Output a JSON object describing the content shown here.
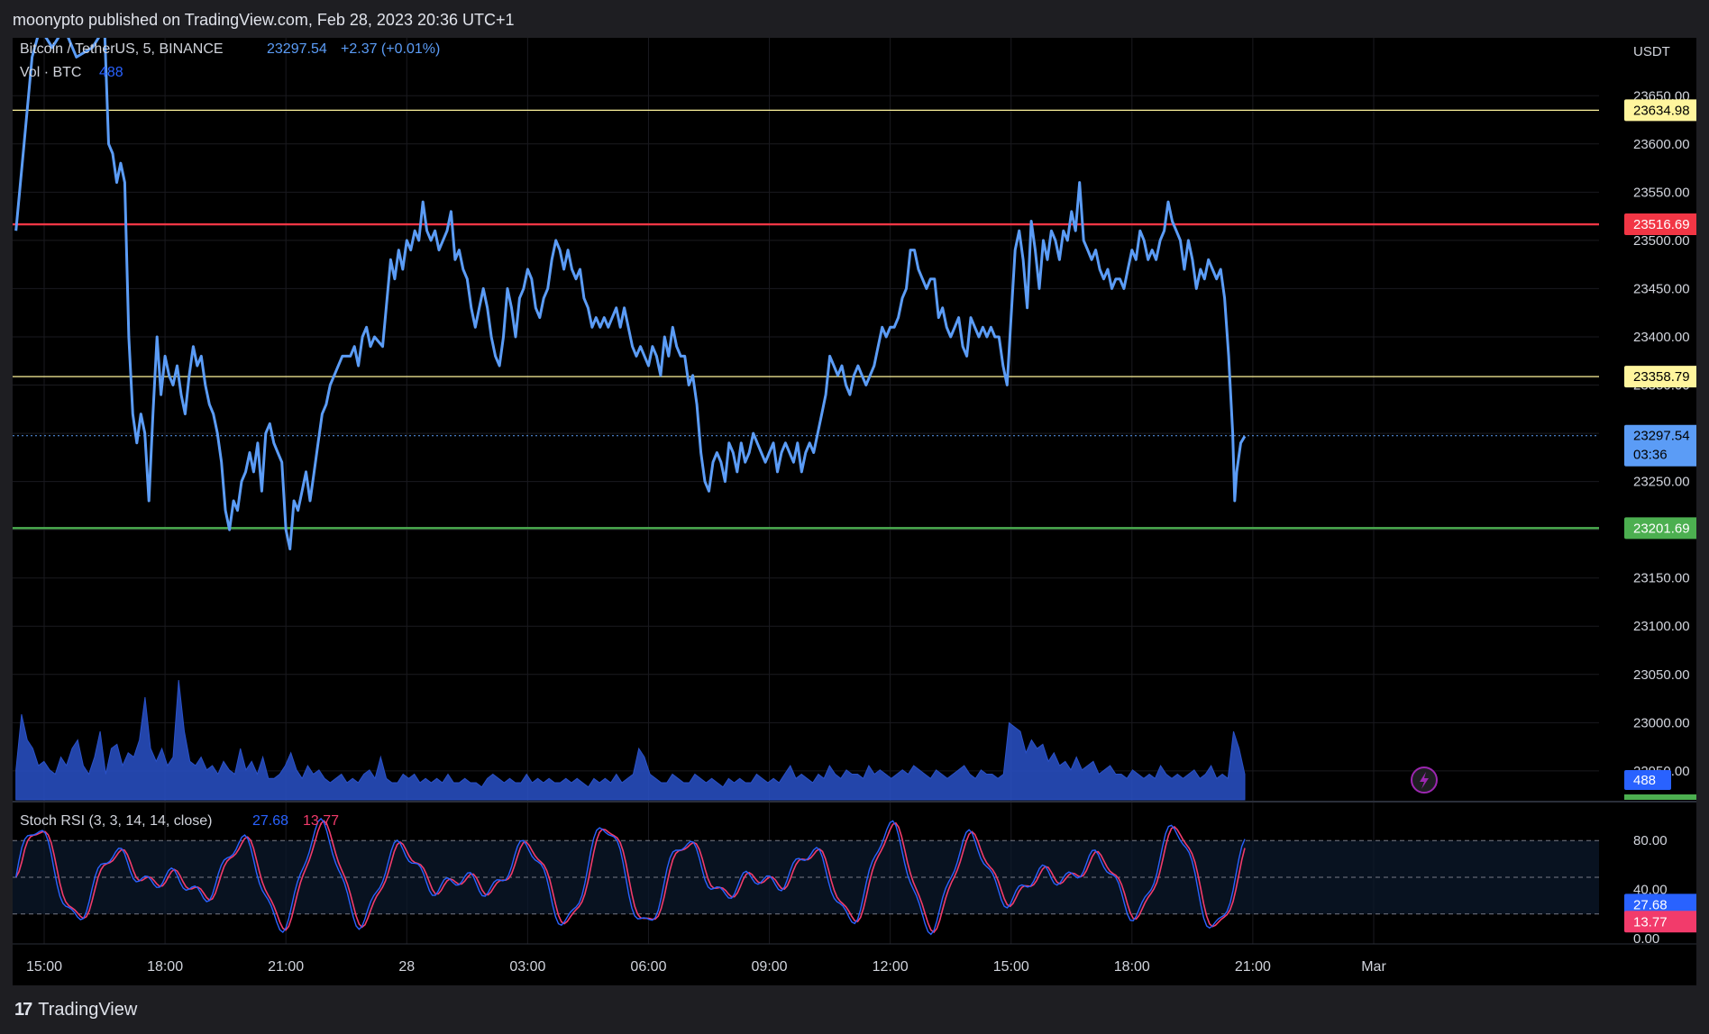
{
  "header": {
    "published": "moonypto published on TradingView.com, Feb 28, 2023 20:36 UTC+1"
  },
  "legend": {
    "symbol": "Bitcoin / TetherUS, 5, BINANCE",
    "price": "23297.54",
    "change": "+2.37 (+0.01%)",
    "volume_label": "Vol · BTC",
    "volume_value": "488"
  },
  "stoch_legend": {
    "label": "Stoch RSI (3, 3, 14, 14, close)",
    "k": "27.68",
    "d": "13.77"
  },
  "footer": {
    "brand": "TradingView",
    "logo_icon": "tradingview-logo-icon"
  },
  "colors": {
    "price_line": "#5b9cf6",
    "resistance": "#f23645",
    "support": "#4caf50",
    "level_yellow": "#fff59d",
    "volume": "#2951c8",
    "stoch_k": "#2962ff",
    "stoch_d": "#f23b6b"
  },
  "chart_data": {
    "type": "line",
    "price_axis": {
      "currency": "USDT",
      "ylim": [
        22920,
        23710
      ],
      "ticks": [
        "23650.00",
        "23600.00",
        "23550.00",
        "23500.00",
        "23450.00",
        "23400.00",
        "23350.00",
        "23300.00",
        "23250.00",
        "23200.00",
        "23150.00",
        "23100.00",
        "23050.00",
        "23000.00",
        "22950.00"
      ]
    },
    "time_axis": {
      "labels": [
        "15:00",
        "18:00",
        "21:00",
        "28",
        "03:00",
        "06:00",
        "09:00",
        "12:00",
        "15:00",
        "18:00",
        "21:00",
        "Mar"
      ],
      "hours": [
        0,
        3,
        6,
        9,
        12,
        15,
        18,
        21,
        24,
        27,
        30,
        33
      ]
    },
    "horizontal_levels": [
      {
        "value": 23634.98,
        "label": "23634.98",
        "color": "#fff59d"
      },
      {
        "value": 23516.69,
        "label": "23516.69",
        "color": "#f23645"
      },
      {
        "value": 23358.79,
        "label": "23358.79",
        "color": "#fff59d"
      },
      {
        "value": 23201.69,
        "label": "23201.69",
        "color": "#4caf50"
      }
    ],
    "last_price": {
      "value": 23297.54,
      "label": "23297.54",
      "countdown": "03:36"
    },
    "price_series": [
      [
        -0.7,
        23510
      ],
      [
        -0.5,
        23600
      ],
      [
        -0.3,
        23690
      ],
      [
        -0.1,
        23720
      ],
      [
        0.2,
        23700
      ],
      [
        0.5,
        23720
      ],
      [
        0.8,
        23690
      ],
      [
        1.2,
        23700
      ],
      [
        1.5,
        23720
      ],
      [
        1.6,
        23600
      ],
      [
        1.7,
        23590
      ],
      [
        1.8,
        23560
      ],
      [
        1.9,
        23580
      ],
      [
        2.0,
        23560
      ],
      [
        2.1,
        23400
      ],
      [
        2.2,
        23320
      ],
      [
        2.3,
        23290
      ],
      [
        2.4,
        23320
      ],
      [
        2.5,
        23300
      ],
      [
        2.6,
        23230
      ],
      [
        2.7,
        23320
      ],
      [
        2.8,
        23400
      ],
      [
        2.9,
        23340
      ],
      [
        3.0,
        23380
      ],
      [
        3.1,
        23360
      ],
      [
        3.2,
        23350
      ],
      [
        3.3,
        23370
      ],
      [
        3.4,
        23340
      ],
      [
        3.5,
        23320
      ],
      [
        3.6,
        23360
      ],
      [
        3.7,
        23390
      ],
      [
        3.8,
        23370
      ],
      [
        3.9,
        23380
      ],
      [
        4.0,
        23350
      ],
      [
        4.1,
        23330
      ],
      [
        4.2,
        23320
      ],
      [
        4.3,
        23300
      ],
      [
        4.4,
        23270
      ],
      [
        4.5,
        23220
      ],
      [
        4.6,
        23200
      ],
      [
        4.7,
        23230
      ],
      [
        4.8,
        23220
      ],
      [
        4.9,
        23250
      ],
      [
        5.0,
        23260
      ],
      [
        5.1,
        23280
      ],
      [
        5.2,
        23260
      ],
      [
        5.3,
        23290
      ],
      [
        5.4,
        23240
      ],
      [
        5.5,
        23300
      ],
      [
        5.6,
        23310
      ],
      [
        5.7,
        23290
      ],
      [
        5.8,
        23280
      ],
      [
        5.9,
        23270
      ],
      [
        6.0,
        23200
      ],
      [
        6.1,
        23180
      ],
      [
        6.2,
        23230
      ],
      [
        6.3,
        23220
      ],
      [
        6.4,
        23240
      ],
      [
        6.5,
        23260
      ],
      [
        6.6,
        23230
      ],
      [
        6.7,
        23260
      ],
      [
        6.8,
        23290
      ],
      [
        6.9,
        23320
      ],
      [
        7.0,
        23330
      ],
      [
        7.1,
        23350
      ],
      [
        7.2,
        23360
      ],
      [
        7.3,
        23370
      ],
      [
        7.4,
        23380
      ],
      [
        7.5,
        23380
      ],
      [
        7.6,
        23380
      ],
      [
        7.7,
        23390
      ],
      [
        7.8,
        23370
      ],
      [
        7.9,
        23400
      ],
      [
        8.0,
        23410
      ],
      [
        8.1,
        23390
      ],
      [
        8.2,
        23400
      ],
      [
        8.4,
        23390
      ],
      [
        8.6,
        23480
      ],
      [
        8.7,
        23460
      ],
      [
        8.8,
        23490
      ],
      [
        8.9,
        23470
      ],
      [
        9.0,
        23500
      ],
      [
        9.1,
        23490
      ],
      [
        9.2,
        23510
      ],
      [
        9.3,
        23500
      ],
      [
        9.4,
        23540
      ],
      [
        9.5,
        23510
      ],
      [
        9.6,
        23500
      ],
      [
        9.7,
        23510
      ],
      [
        9.8,
        23490
      ],
      [
        10.0,
        23510
      ],
      [
        10.1,
        23530
      ],
      [
        10.2,
        23480
      ],
      [
        10.3,
        23490
      ],
      [
        10.4,
        23470
      ],
      [
        10.5,
        23460
      ],
      [
        10.6,
        23430
      ],
      [
        10.7,
        23410
      ],
      [
        10.8,
        23430
      ],
      [
        10.9,
        23450
      ],
      [
        11.0,
        23430
      ],
      [
        11.1,
        23400
      ],
      [
        11.2,
        23380
      ],
      [
        11.3,
        23370
      ],
      [
        11.4,
        23400
      ],
      [
        11.5,
        23450
      ],
      [
        11.6,
        23430
      ],
      [
        11.7,
        23400
      ],
      [
        11.8,
        23440
      ],
      [
        11.9,
        23450
      ],
      [
        12.0,
        23470
      ],
      [
        12.1,
        23460
      ],
      [
        12.2,
        23430
      ],
      [
        12.3,
        23420
      ],
      [
        12.4,
        23440
      ],
      [
        12.5,
        23450
      ],
      [
        12.6,
        23480
      ],
      [
        12.7,
        23500
      ],
      [
        12.8,
        23490
      ],
      [
        12.9,
        23470
      ],
      [
        13.0,
        23490
      ],
      [
        13.1,
        23470
      ],
      [
        13.2,
        23460
      ],
      [
        13.3,
        23470
      ],
      [
        13.4,
        23440
      ],
      [
        13.5,
        23430
      ],
      [
        13.6,
        23410
      ],
      [
        13.7,
        23420
      ],
      [
        13.8,
        23410
      ],
      [
        13.9,
        23420
      ],
      [
        14.0,
        23410
      ],
      [
        14.1,
        23420
      ],
      [
        14.2,
        23430
      ],
      [
        14.3,
        23410
      ],
      [
        14.4,
        23430
      ],
      [
        14.5,
        23410
      ],
      [
        14.6,
        23390
      ],
      [
        14.7,
        23380
      ],
      [
        14.8,
        23390
      ],
      [
        14.9,
        23380
      ],
      [
        15.0,
        23370
      ],
      [
        15.1,
        23390
      ],
      [
        15.2,
        23380
      ],
      [
        15.3,
        23360
      ],
      [
        15.4,
        23400
      ],
      [
        15.5,
        23380
      ],
      [
        15.6,
        23410
      ],
      [
        15.7,
        23390
      ],
      [
        15.8,
        23380
      ],
      [
        15.9,
        23380
      ],
      [
        16.0,
        23350
      ],
      [
        16.1,
        23360
      ],
      [
        16.2,
        23330
      ],
      [
        16.3,
        23280
      ],
      [
        16.4,
        23250
      ],
      [
        16.5,
        23240
      ],
      [
        16.6,
        23270
      ],
      [
        16.7,
        23280
      ],
      [
        16.8,
        23270
      ],
      [
        16.9,
        23250
      ],
      [
        17.0,
        23290
      ],
      [
        17.1,
        23280
      ],
      [
        17.2,
        23260
      ],
      [
        17.3,
        23290
      ],
      [
        17.4,
        23270
      ],
      [
        17.5,
        23280
      ],
      [
        17.6,
        23300
      ],
      [
        17.7,
        23290
      ],
      [
        17.8,
        23280
      ],
      [
        17.9,
        23270
      ],
      [
        18.0,
        23280
      ],
      [
        18.1,
        23290
      ],
      [
        18.2,
        23260
      ],
      [
        18.3,
        23280
      ],
      [
        18.4,
        23290
      ],
      [
        18.5,
        23280
      ],
      [
        18.6,
        23270
      ],
      [
        18.7,
        23290
      ],
      [
        18.8,
        23260
      ],
      [
        18.9,
        23280
      ],
      [
        19.0,
        23290
      ],
      [
        19.1,
        23280
      ],
      [
        19.2,
        23300
      ],
      [
        19.3,
        23320
      ],
      [
        19.4,
        23340
      ],
      [
        19.5,
        23380
      ],
      [
        19.6,
        23370
      ],
      [
        19.7,
        23360
      ],
      [
        19.8,
        23370
      ],
      [
        19.9,
        23350
      ],
      [
        20.0,
        23340
      ],
      [
        20.1,
        23360
      ],
      [
        20.2,
        23370
      ],
      [
        20.3,
        23360
      ],
      [
        20.4,
        23350
      ],
      [
        20.5,
        23360
      ],
      [
        20.6,
        23370
      ],
      [
        20.7,
        23390
      ],
      [
        20.8,
        23410
      ],
      [
        20.9,
        23400
      ],
      [
        21.0,
        23410
      ],
      [
        21.1,
        23410
      ],
      [
        21.2,
        23420
      ],
      [
        21.3,
        23440
      ],
      [
        21.4,
        23450
      ],
      [
        21.5,
        23490
      ],
      [
        21.6,
        23490
      ],
      [
        21.7,
        23470
      ],
      [
        21.8,
        23460
      ],
      [
        21.9,
        23450
      ],
      [
        22.0,
        23460
      ],
      [
        22.1,
        23460
      ],
      [
        22.2,
        23420
      ],
      [
        22.3,
        23430
      ],
      [
        22.4,
        23410
      ],
      [
        22.5,
        23400
      ],
      [
        22.6,
        23410
      ],
      [
        22.7,
        23420
      ],
      [
        22.8,
        23390
      ],
      [
        22.9,
        23380
      ],
      [
        23.0,
        23420
      ],
      [
        23.1,
        23410
      ],
      [
        23.2,
        23400
      ],
      [
        23.3,
        23410
      ],
      [
        23.4,
        23400
      ],
      [
        23.5,
        23410
      ],
      [
        23.6,
        23400
      ],
      [
        23.7,
        23400
      ],
      [
        23.8,
        23370
      ],
      [
        23.9,
        23350
      ],
      [
        24.0,
        23420
      ],
      [
        24.1,
        23490
      ],
      [
        24.2,
        23510
      ],
      [
        24.3,
        23480
      ],
      [
        24.4,
        23430
      ],
      [
        24.5,
        23520
      ],
      [
        24.6,
        23490
      ],
      [
        24.7,
        23450
      ],
      [
        24.8,
        23500
      ],
      [
        24.9,
        23480
      ],
      [
        25.0,
        23510
      ],
      [
        25.1,
        23500
      ],
      [
        25.2,
        23480
      ],
      [
        25.3,
        23510
      ],
      [
        25.4,
        23500
      ],
      [
        25.5,
        23530
      ],
      [
        25.6,
        23510
      ],
      [
        25.7,
        23560
      ],
      [
        25.8,
        23500
      ],
      [
        25.9,
        23490
      ],
      [
        26.0,
        23480
      ],
      [
        26.1,
        23490
      ],
      [
        26.2,
        23470
      ],
      [
        26.3,
        23460
      ],
      [
        26.4,
        23470
      ],
      [
        26.5,
        23450
      ],
      [
        26.6,
        23460
      ],
      [
        26.7,
        23460
      ],
      [
        26.8,
        23450
      ],
      [
        26.9,
        23470
      ],
      [
        27.0,
        23490
      ],
      [
        27.1,
        23480
      ],
      [
        27.2,
        23510
      ],
      [
        27.3,
        23500
      ],
      [
        27.4,
        23480
      ],
      [
        27.5,
        23490
      ],
      [
        27.6,
        23480
      ],
      [
        27.7,
        23500
      ],
      [
        27.8,
        23510
      ],
      [
        27.9,
        23540
      ],
      [
        28.0,
        23520
      ],
      [
        28.1,
        23510
      ],
      [
        28.2,
        23500
      ],
      [
        28.3,
        23470
      ],
      [
        28.4,
        23500
      ],
      [
        28.5,
        23480
      ],
      [
        28.6,
        23450
      ],
      [
        28.7,
        23470
      ],
      [
        28.8,
        23460
      ],
      [
        28.9,
        23480
      ],
      [
        29.0,
        23470
      ],
      [
        29.1,
        23460
      ],
      [
        29.2,
        23470
      ],
      [
        29.3,
        23440
      ],
      [
        29.4,
        23380
      ],
      [
        29.5,
        23300
      ],
      [
        29.55,
        23230
      ],
      [
        29.6,
        23260
      ],
      [
        29.7,
        23290
      ],
      [
        29.8,
        23297
      ]
    ],
    "volume_series": {
      "ylim": [
        0,
        200
      ],
      "last": 488,
      "values": [
        35,
        100,
        70,
        60,
        40,
        45,
        35,
        30,
        50,
        40,
        60,
        70,
        40,
        30,
        50,
        80,
        30,
        60,
        65,
        40,
        55,
        50,
        70,
        120,
        60,
        45,
        60,
        40,
        50,
        140,
        80,
        45,
        40,
        50,
        35,
        40,
        30,
        45,
        35,
        30,
        60,
        35,
        45,
        30,
        50,
        25,
        25,
        30,
        40,
        55,
        35,
        25,
        40,
        30,
        35,
        25,
        20,
        25,
        30,
        20,
        25,
        20,
        30,
        35,
        25,
        50,
        25,
        20,
        20,
        30,
        25,
        30,
        20,
        25,
        20,
        25,
        20,
        30,
        20,
        20,
        25,
        20,
        20,
        15,
        25,
        30,
        25,
        20,
        25,
        20,
        20,
        30,
        20,
        25,
        20,
        25,
        20,
        20,
        25,
        20,
        25,
        20,
        15,
        25,
        20,
        25,
        20,
        30,
        20,
        25,
        30,
        60,
        50,
        30,
        25,
        20,
        20,
        30,
        25,
        20,
        20,
        30,
        25,
        20,
        25,
        20,
        15,
        25,
        20,
        25,
        20,
        20,
        30,
        25,
        20,
        25,
        20,
        30,
        40,
        25,
        30,
        25,
        20,
        30,
        25,
        40,
        30,
        25,
        35,
        30,
        30,
        25,
        40,
        30,
        35,
        30,
        25,
        30,
        35,
        30,
        40,
        35,
        30,
        25,
        35,
        30,
        25,
        30,
        35,
        40,
        30,
        25,
        35,
        30,
        30,
        25,
        30,
        90,
        85,
        80,
        55,
        70,
        60,
        65,
        45,
        55,
        40,
        45,
        35,
        50,
        35,
        40,
        45,
        30,
        35,
        40,
        30,
        30,
        25,
        35,
        30,
        25,
        30,
        25,
        40,
        30,
        25,
        30,
        25,
        30,
        35,
        25,
        30,
        40,
        25,
        30,
        25,
        80,
        60,
        30
      ]
    },
    "stoch_rsi": {
      "ylim": [
        0,
        100
      ],
      "ticks": [
        "80.00",
        "40.00",
        "0.00"
      ],
      "bands": [
        80,
        50,
        20
      ],
      "k_last": 27.68,
      "d_last": 13.77
    }
  }
}
